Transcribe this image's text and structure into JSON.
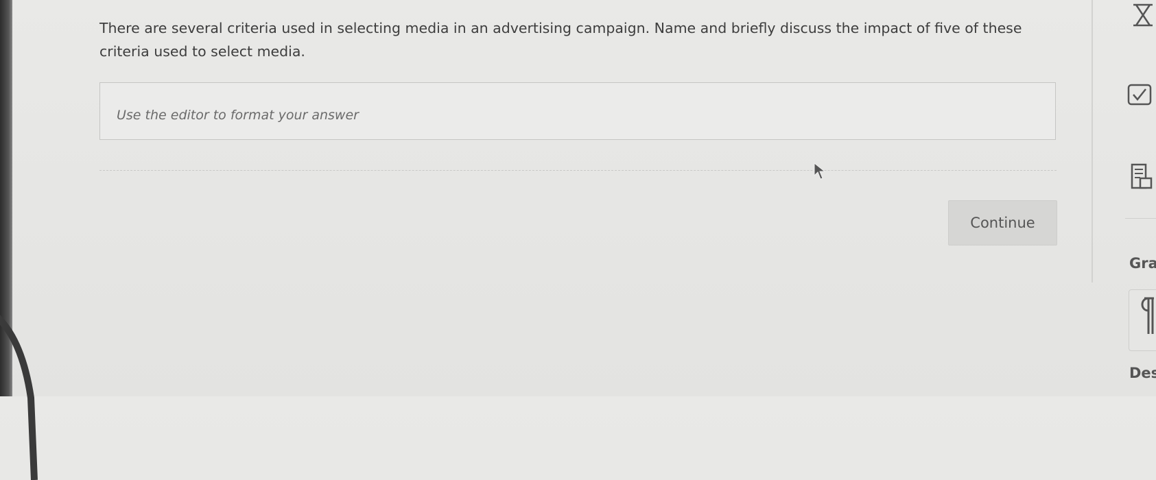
{
  "question": {
    "text": "There are several criteria used in selecting media in an advertising campaign. Name and briefly discuss the impact of five of these criteria used to select media."
  },
  "answer": {
    "placeholder": "Use the editor to format your answer",
    "value": ""
  },
  "actions": {
    "continue_label": "Continue"
  },
  "right_rail": {
    "icons": [
      "hourglass-icon",
      "checkbox-icon",
      "document-icon",
      "paragraph-icon"
    ],
    "labels": [
      "Gra",
      "Des"
    ]
  }
}
